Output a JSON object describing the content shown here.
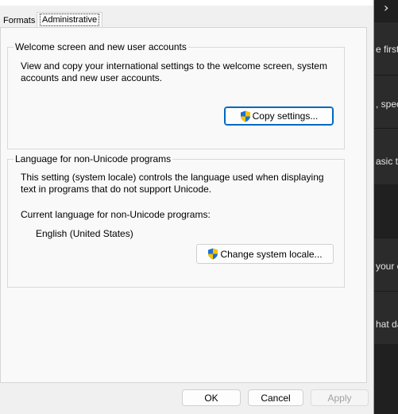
{
  "background_app": {
    "snippets": [
      "e first",
      ", spec",
      "asic ty",
      "your c",
      "hat da"
    ]
  },
  "tabs": [
    {
      "label": "Formats"
    },
    {
      "label": "Administrative"
    }
  ],
  "welcome_group": {
    "title": "Welcome screen and new user accounts",
    "description_line1": "View and copy your international settings to the welcome screen, system",
    "description_line2": "accounts and new user accounts.",
    "copy_button": "Copy settings..."
  },
  "language_group": {
    "title": "Language for non-Unicode programs",
    "description_line1": "This setting (system locale) controls the language used when displaying",
    "description_line2": "text in programs that do not support Unicode.",
    "current_label": "Current language for non-Unicode programs:",
    "current_value": "English (United States)",
    "change_button": "Change system locale..."
  },
  "footer": {
    "ok": "OK",
    "cancel": "Cancel",
    "apply": "Apply"
  },
  "colors": {
    "accent": "#0067c0",
    "dialog_bg": "#f0f0f0",
    "page_bg": "#f9f9f9",
    "background_app": "#202020"
  }
}
